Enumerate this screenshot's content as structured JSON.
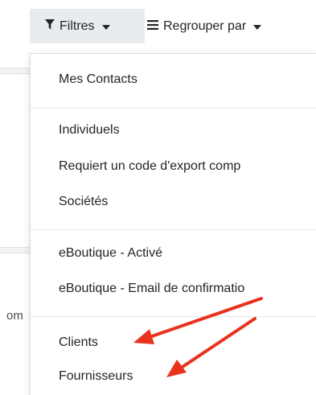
{
  "toolbar": {
    "filters_label": "Filtres",
    "group_by_label": "Regrouper par",
    "filters_icon": "funnel-icon",
    "group_by_icon": "bars-icon"
  },
  "background": {
    "partial_text": "om"
  },
  "menu": {
    "items": [
      {
        "label": "Mes Contacts"
      },
      {
        "label": "Individuels"
      },
      {
        "label": "Requiert un code d'export comp"
      },
      {
        "label": "Sociétés"
      },
      {
        "label": "eBoutique - Activé"
      },
      {
        "label": "eBoutique - Email de confirmatio"
      },
      {
        "label": "Clients"
      },
      {
        "label": "Fournisseurs"
      }
    ]
  },
  "annotation": {
    "arrow_color": "#e8321e"
  }
}
